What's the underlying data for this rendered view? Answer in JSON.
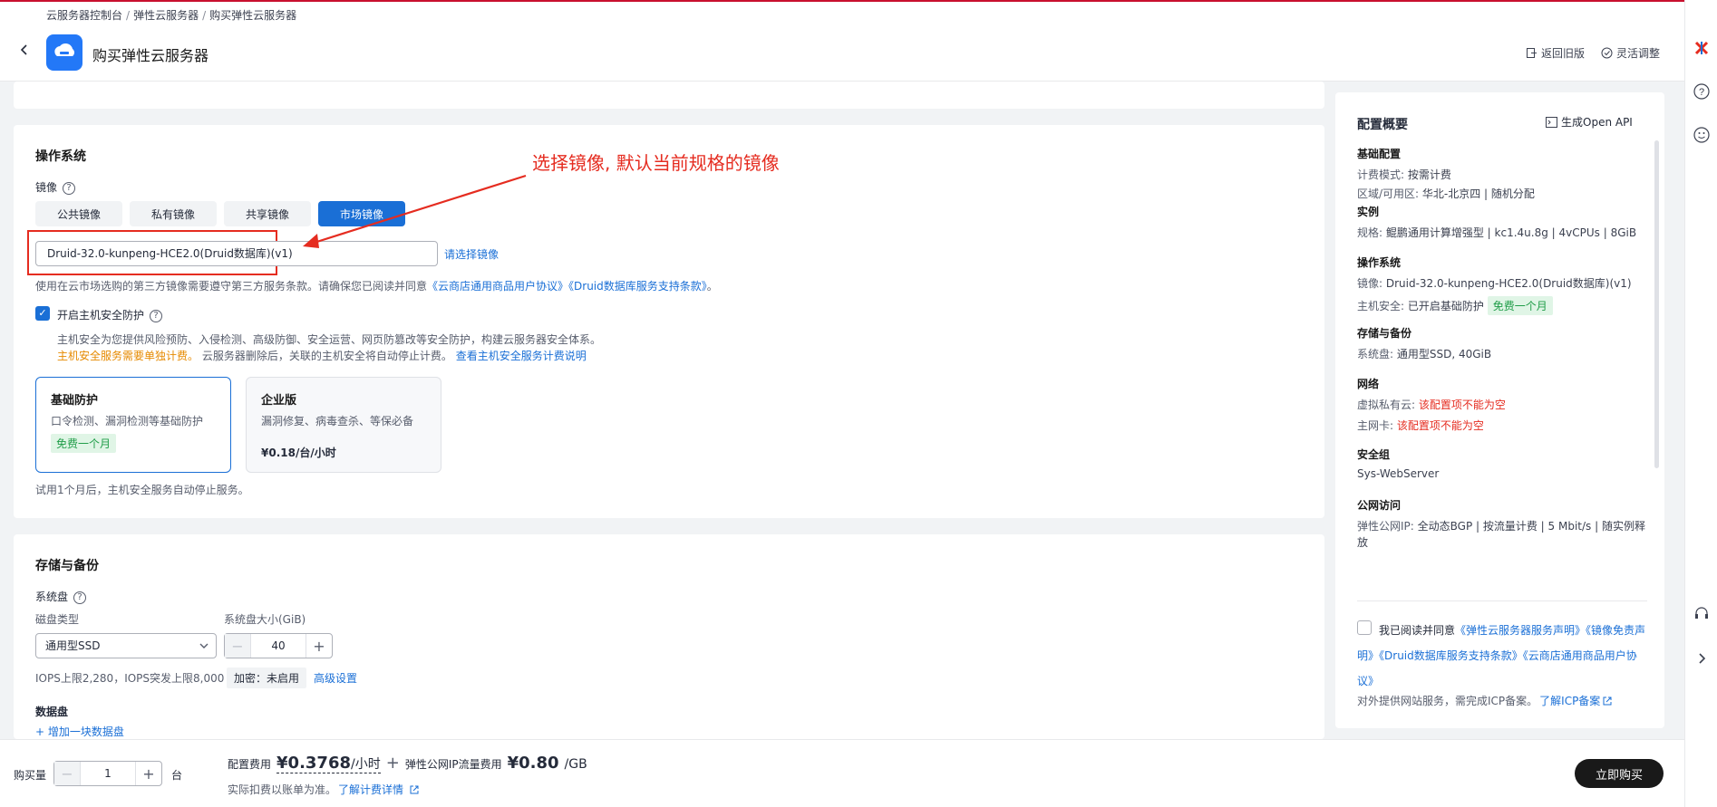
{
  "breadcrumb": {
    "items": [
      "云服务器控制台",
      "弹性云服务器",
      "购买弹性云服务器"
    ]
  },
  "header": {
    "title": "购买弹性云服务器",
    "old_version": "返回旧版",
    "flex_adjust": "灵活调整"
  },
  "os_section": {
    "title": "操作系统",
    "image_label": "镜像",
    "tabs": [
      {
        "label": "公共镜像",
        "active": false
      },
      {
        "label": "私有镜像",
        "active": false
      },
      {
        "label": "共享镜像",
        "active": false
      },
      {
        "label": "市场镜像",
        "active": true
      }
    ],
    "selected_image": "Druid-32.0-kunpeng-HCE2.0(Druid数据库)(v1)",
    "choose_image_link": "请选择镜像",
    "notice_prefix": "使用在云市场选购的第三方镜像需要遵守第三方服务条款。请确保您已阅读并同意",
    "notice_link1": "《云商店通用商品用户协议》",
    "notice_link2": "《Druid数据库服务支持条款》",
    "notice_suffix": "。",
    "host_security_label": "开启主机安全防护",
    "host_security_desc": "主机安全为您提供风险预防、入侵检测、高级防御、安全运营、网页防篡改等安全防护，构建云服务器安全体系。",
    "host_security_warn": "主机安全服务需要单独计费。",
    "host_security_note": "云服务器删除后，关联的主机安全将自动停止计费。",
    "host_security_link": "查看主机安全服务计费说明",
    "options": [
      {
        "title": "基础防护",
        "desc": "口令检测、漏洞检测等基础防护",
        "tag": "免费一个月",
        "price": "",
        "active": true
      },
      {
        "title": "企业版",
        "desc": "漏洞修复、病毒查杀、等保必备",
        "tag": "",
        "price": "¥0.18/台/小时",
        "active": false
      }
    ],
    "trial_note": "试用1个月后，主机安全服务自动停止服务。"
  },
  "annotation": "选择镜像, 默认当前规格的镜像",
  "storage_section": {
    "title": "存储与备份",
    "system_disk_label": "系统盘",
    "disk_type_label": "磁盘类型",
    "disk_size_label": "系统盘大小(GiB)",
    "disk_type_value": "通用型SSD",
    "disk_size_value": "40",
    "iops_text": "IOPS上限2,280，IOPS突发上限8,000",
    "encryption_tag": "加密：未启用",
    "advanced_link": "高级设置",
    "data_disk_label": "数据盘",
    "add_data_disk": "+ 增加一块数据盘"
  },
  "summary": {
    "title": "配置概要",
    "open_api": "生成Open API",
    "groups": [
      {
        "heading": "基础配置",
        "lines": [
          {
            "k": "计费模式: ",
            "v": "按需计费",
            "red": false
          },
          {
            "k": "区域/可用区: ",
            "v": "华北-北京四 | 随机分配",
            "red": false
          }
        ]
      },
      {
        "heading": "实例",
        "lines": [
          {
            "k": "规格: ",
            "v": "鲲鹏通用计算增强型 | kc1.4u.8g | 4vCPUs | 8GiB",
            "red": false
          }
        ]
      },
      {
        "heading": "操作系统",
        "lines": [
          {
            "k": "镜像: ",
            "v": "Druid-32.0-kunpeng-HCE2.0(Druid数据库)(v1)",
            "red": false
          },
          {
            "k": "主机安全: ",
            "v": "已开启基础防护",
            "red": false
          }
        ]
      },
      {
        "heading": "存储与备份",
        "lines": [
          {
            "k": "系统盘: ",
            "v": "通用型SSD, 40GiB",
            "red": false
          }
        ]
      },
      {
        "heading": "网络",
        "lines": [
          {
            "k": "虚拟私有云: ",
            "v": "该配置项不能为空",
            "red": true
          },
          {
            "k": "主网卡: ",
            "v": "该配置项不能为空",
            "red": true
          }
        ]
      },
      {
        "heading": "安全组",
        "lines": [
          {
            "k": "",
            "v": "Sys-WebServer",
            "red": false
          }
        ]
      },
      {
        "heading": "公网访问",
        "lines": [
          {
            "k": "弹性公网IP: ",
            "v": "全动态BGP | 按流量计费 | 5 Mbit/s | 随实例释放",
            "red": false
          }
        ]
      }
    ],
    "host_sec_tag": "免费一个月",
    "agree_prefix": "我已阅读并同意",
    "agree_link1": "《弹性云服务器服务声明》",
    "agree_link2": "《镜像免责声明》",
    "agree_link3": "《Druid数据库服务支持条款》",
    "agree_link4": "《云商店通用商品用户协议》",
    "icp_note": "对外提供网站服务，需完成ICP备案。",
    "icp_link": "了解ICP备案"
  },
  "footer": {
    "qty_label": "购买量",
    "qty_value": "1",
    "qty_unit": "台",
    "config_fee_label": "配置费用",
    "config_fee_value": "¥0.3768",
    "config_fee_unit": "/小时",
    "plus": "+",
    "eip_fee_label": "弹性公网IP流量费用",
    "eip_fee_value": "¥0.80",
    "eip_fee_unit": "/GB",
    "billing_note": "实际扣费以账单为准。",
    "billing_link": "了解计费详情",
    "buy_button": "立即购买"
  },
  "colors": {
    "brand": "#1a6fd6",
    "annotation": "#e52c20",
    "free_tag": "#1f9d48"
  }
}
